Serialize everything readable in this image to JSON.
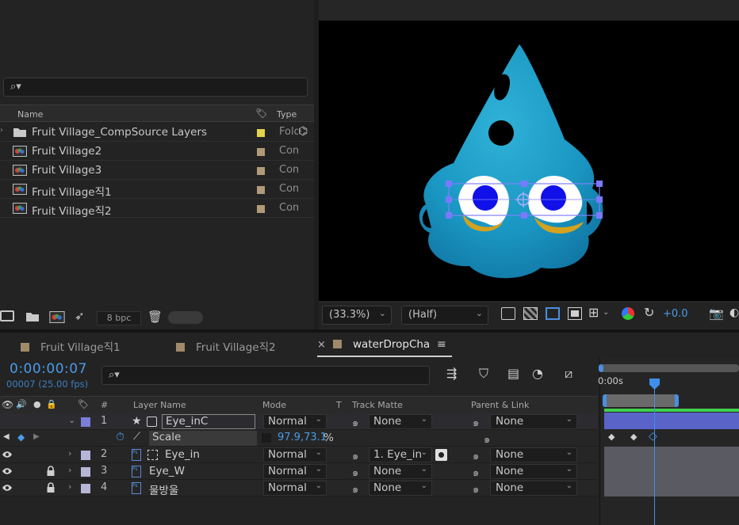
{
  "project": {
    "search_placeholder": "",
    "columns": {
      "name": "Name",
      "type": "Type"
    },
    "items": [
      {
        "name": "Fruit Village_CompSource Layers",
        "type": "Folder",
        "icon": "folder-icon",
        "color": "#e3d34a"
      },
      {
        "name": "Fruit Village2",
        "type": "Composition",
        "icon": "composition-icon",
        "color": "#b09a7a"
      },
      {
        "name": "Fruit Village3",
        "type": "Composition",
        "icon": "composition-icon",
        "color": "#b09a7a"
      },
      {
        "name": "Fruit Village직1",
        "type": "Composition",
        "icon": "composition-icon",
        "color": "#b09a7a"
      },
      {
        "name": "Fruit Village직2",
        "type": "Composition",
        "icon": "composition-icon",
        "color": "#b09a7a"
      }
    ],
    "bpc": "8 bpc"
  },
  "viewer": {
    "zoom": "(33.3%)",
    "resolution": "(Half)",
    "exposure": "+0.0"
  },
  "timeline": {
    "tabs": [
      {
        "label": "Fruit Village직1",
        "color": "#a08a6a",
        "active": false
      },
      {
        "label": "Fruit Village직2",
        "color": "#a08a6a",
        "active": false
      },
      {
        "label": "waterDropCha",
        "color": "#a08a6a",
        "active": true
      }
    ],
    "close_glyph": "×",
    "menu_glyph": "≡",
    "timecode": "0:00:00:07",
    "frames": "00007 (25.00 fps)",
    "ruler_label": "0:00s",
    "columns": {
      "num": "#",
      "layer_name": "Layer Name",
      "mode": "Mode",
      "t": "T",
      "track_matte": "Track Matte",
      "parent": "Parent & Link"
    },
    "layers": [
      {
        "num": "1",
        "name": "Eye_inC",
        "mode": "Normal",
        "matte": "None",
        "parent": "None",
        "color": "#7a7ed8"
      },
      {
        "num": "2",
        "name": "Eye_in",
        "mode": "Normal",
        "matte": "1. Eye_in",
        "parent": "None",
        "color": "#b6b6d8"
      },
      {
        "num": "3",
        "name": "Eye_W",
        "mode": "Normal",
        "matte": "None",
        "parent": "None",
        "color": "#b6b6d8"
      },
      {
        "num": "4",
        "name": "물방울",
        "mode": "Normal",
        "matte": "None",
        "parent": "None",
        "color": "#b6b6d8"
      }
    ],
    "property": {
      "name": "Scale",
      "value": "97.9,73.1",
      "unit": "%"
    }
  }
}
